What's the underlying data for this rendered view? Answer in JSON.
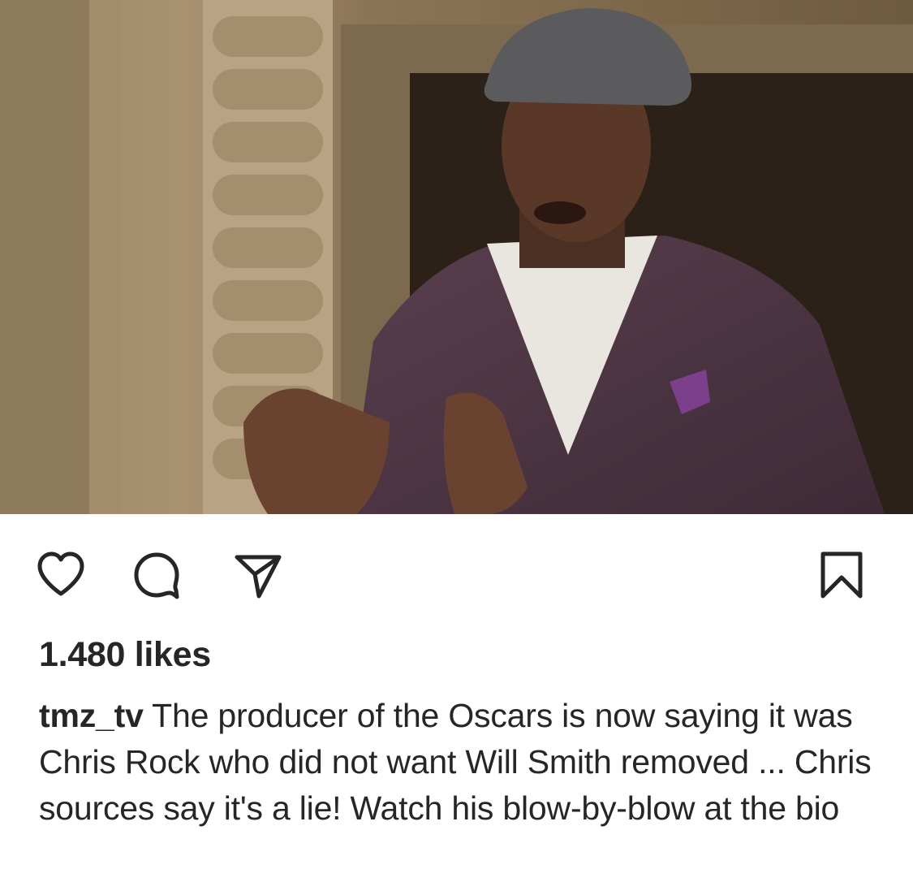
{
  "post": {
    "image": {
      "icon": "photo-of-man-in-flat-cap-and-purple-blazer"
    },
    "actions": {
      "like_icon": "heart-icon",
      "comment_icon": "comment-bubble-icon",
      "share_icon": "paper-plane-icon",
      "save_icon": "bookmark-icon"
    },
    "likes_text": "1.480 likes",
    "caption": {
      "username": "tmz_tv",
      "text": "The producer of the Oscars is now saying it was Chris Rock who did not want Will Smith removed ... Chris sources say it's a lie! Watch his blow-by-blow at the bio"
    }
  },
  "colors": {
    "text": "#262626",
    "background": "#ffffff"
  }
}
